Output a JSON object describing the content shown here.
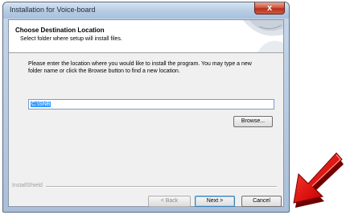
{
  "window": {
    "title": "Installation for Voice-board",
    "close_symbol": "x"
  },
  "header": {
    "title": "Choose Destination Location",
    "subtitle": "Select folder where setup will install files."
  },
  "body": {
    "instructions": "Please enter the location where you would like to install the program.  You may type a new folder name or click the Browse button to find a new location.",
    "path_value": "C:\\SNB"
  },
  "buttons": {
    "browse": "Browse...",
    "back": "< Back",
    "next": "Next >",
    "cancel": "Cancel"
  },
  "footer": {
    "brand": "InstallShield"
  },
  "decoration": {
    "arrow_icon": "red-pointer-arrow-icon",
    "arrow_color": "#e01010"
  }
}
